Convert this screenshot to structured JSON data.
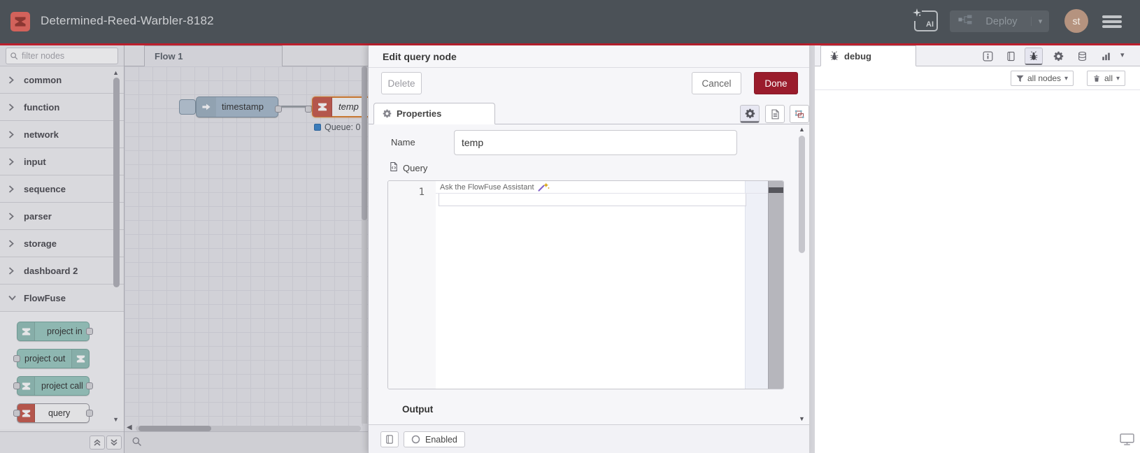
{
  "header": {
    "title": "Determined-Reed-Warbler-8182",
    "ai_label": "AI",
    "deploy_label": "Deploy",
    "avatar_initials": "st"
  },
  "palette": {
    "filter_placeholder": "filter nodes",
    "categories": [
      {
        "label": "common"
      },
      {
        "label": "function"
      },
      {
        "label": "network"
      },
      {
        "label": "input"
      },
      {
        "label": "sequence"
      },
      {
        "label": "parser"
      },
      {
        "label": "storage"
      },
      {
        "label": "dashboard 2"
      },
      {
        "label": "FlowFuse",
        "expanded": true
      }
    ],
    "flowfuse_nodes": [
      {
        "label": "project in"
      },
      {
        "label": "project out"
      },
      {
        "label": "project call"
      },
      {
        "label": "query"
      }
    ]
  },
  "canvas": {
    "tab_label": "Flow 1",
    "inject_node_label": "timestamp",
    "query_node_label": "temp",
    "status_text": "Queue: 0"
  },
  "dialog": {
    "title": "Edit query node",
    "delete_label": "Delete",
    "cancel_label": "Cancel",
    "done_label": "Done",
    "properties_tab_label": "Properties",
    "name_label": "Name",
    "name_value": "temp",
    "query_label": "Query",
    "editor": {
      "line_number": "1",
      "assistant_hint": "Ask the FlowFuse Assistant"
    },
    "output_label": "Output",
    "enabled_label": "Enabled"
  },
  "debug": {
    "tab_label": "debug",
    "filter_all_nodes_label": "all nodes",
    "clear_all_label": "all"
  },
  "icons": {
    "caret_down": "▾",
    "scroll_up": "▲",
    "scroll_down": "▼",
    "scroll_left": "◀"
  },
  "colors": {
    "header_bg": "#4b5157",
    "top_border_red": "#bb1f2d",
    "done_button_red": "#9a1c2c",
    "flowfuse_salmon": "#d2625b",
    "node_teal": "#9ccbc2",
    "query_icon_red": "#c75b4e",
    "status_blue": "#3c87cc",
    "selected_orange": "#dd8332"
  }
}
